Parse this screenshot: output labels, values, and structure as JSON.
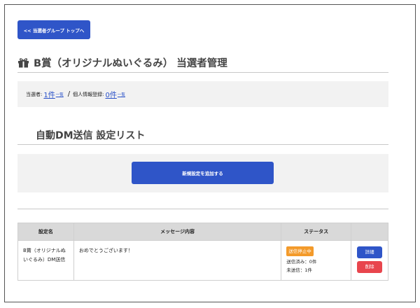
{
  "nav": {
    "back_label": "<< 当選者グループ トップへ"
  },
  "page": {
    "title": "B賞（オリジナルぬいぐるみ） 当選者管理",
    "icon": "gift-icon"
  },
  "summary": {
    "winners_label": "当選者:",
    "winners_count": "1件",
    "winners_list_link": "一覧",
    "separator": "/",
    "registered_label": "個人情報登録:",
    "registered_count": "0件",
    "registered_list_link": "一覧"
  },
  "section": {
    "title": "自動DM送信 設定リスト"
  },
  "add_button": {
    "label": "新規設定を追加する"
  },
  "table": {
    "headers": {
      "name": "設定名",
      "message": "メッセージ内容",
      "status": "ステータス",
      "actions": ""
    },
    "rows": [
      {
        "name_line1": "B賞（オリジナルぬ",
        "name_line2": "いぐるみ）DM送信",
        "message": "おめでとうございます！",
        "status_badge": "送信停止中",
        "sent": "送信済み：0件",
        "unsent": "未送信：1件",
        "detail_label": "詳細",
        "delete_label": "削除"
      }
    ]
  },
  "colors": {
    "primary": "#2f55c8",
    "danger": "#e8454d",
    "warning": "#f39a2a",
    "panel": "#f2f2f2"
  }
}
